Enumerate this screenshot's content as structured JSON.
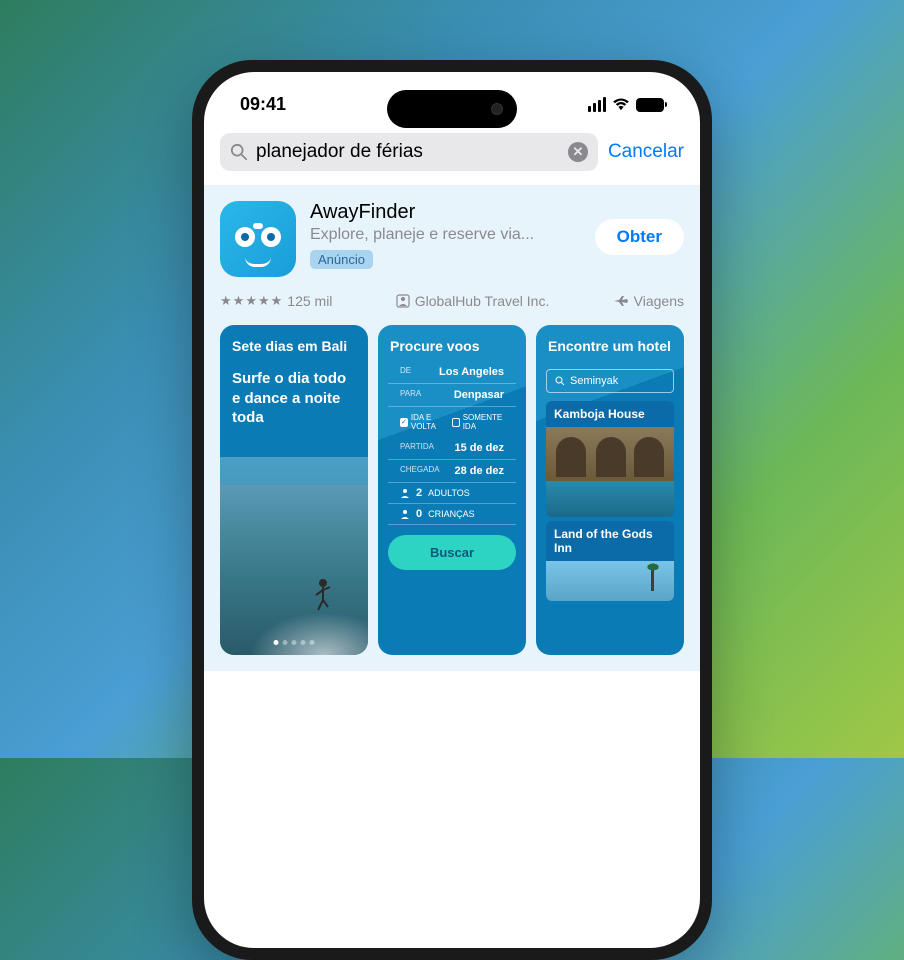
{
  "status": {
    "time": "09:41"
  },
  "search": {
    "query": "planejador de férias",
    "cancel": "Cancelar"
  },
  "app": {
    "name": "AwayFinder",
    "subtitle": "Explore, planeje e reserve via...",
    "ad_label": "Anúncio",
    "get_button": "Obter",
    "rating_count": "125 mil",
    "developer": "GlobalHub Travel Inc.",
    "category": "Viagens"
  },
  "shots": {
    "s1": {
      "title": "Sete dias em Bali",
      "subtitle": "Surfe o dia todo e dance a noite toda"
    },
    "s2": {
      "title": "Procure voos",
      "from_label": "DE",
      "from": "Los Angeles",
      "to_label": "PARA",
      "to": "Denpasar",
      "roundtrip": "IDA E VOLTA",
      "oneway": "SOMENTE IDA",
      "depart_label": "PARTIDA",
      "depart": "15 de dez",
      "arrive_label": "CHEGADA",
      "arrive": "28 de dez",
      "adults_count": "2",
      "adults": "ADULTOS",
      "children_count": "0",
      "children": "CRIANÇAS",
      "search_btn": "Buscar"
    },
    "s3": {
      "title": "Encontre um hotel",
      "search": "Seminyak",
      "hotel1": "Kamboja House",
      "hotel2": "Land of the Gods Inn"
    }
  }
}
